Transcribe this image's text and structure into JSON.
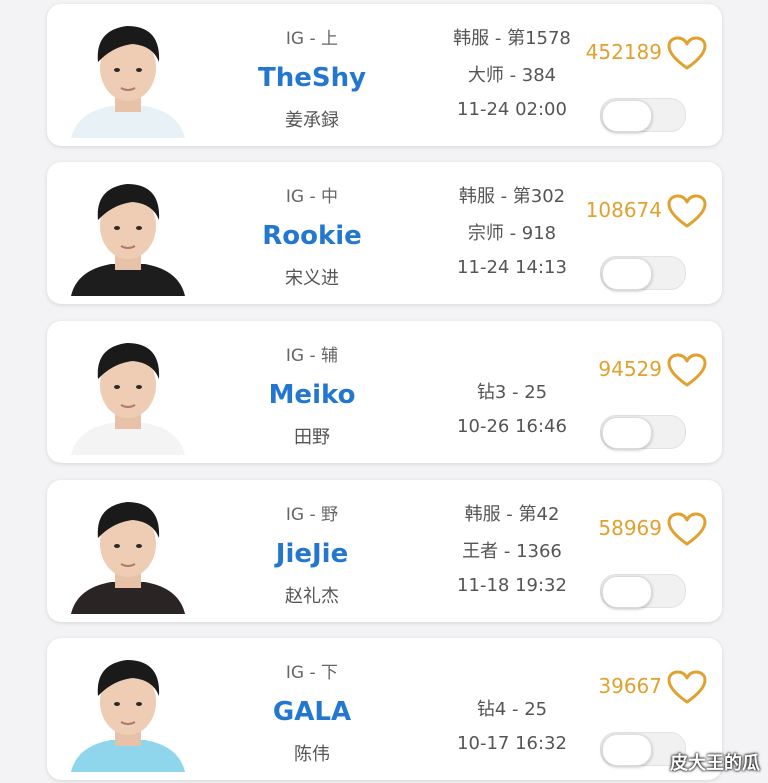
{
  "players": [
    {
      "team": "IG - 上",
      "name": "TheShy",
      "realname": "姜承録",
      "stats": [
        "韩服 - 第1578",
        "大师 - 384",
        "11-24 02:00"
      ],
      "votes": "452189",
      "shirt": "#e8f1f6"
    },
    {
      "team": "IG - 中",
      "name": "Rookie",
      "realname": "宋义进",
      "stats": [
        "韩服 - 第302",
        "宗师 - 918",
        "11-24 14:13"
      ],
      "votes": "108674",
      "shirt": "#1d1d1d"
    },
    {
      "team": "IG - 辅",
      "name": "Meiko",
      "realname": "田野",
      "stats": [
        "钻3 - 25",
        "10-26 16:46"
      ],
      "votes": "94529",
      "shirt": "#f4f4f4"
    },
    {
      "team": "IG - 野",
      "name": "JieJie",
      "realname": "赵礼杰",
      "stats": [
        "韩服 - 第42",
        "王者 - 1366",
        "11-18 19:32"
      ],
      "votes": "58969",
      "shirt": "#2a2424"
    },
    {
      "team": "IG - 下",
      "name": "GALA",
      "realname": "陈伟",
      "stats": [
        "钻4 - 25",
        "10-17 16:32"
      ],
      "votes": "39667",
      "shirt": "#8fd6ec"
    }
  ],
  "watermark": "皮大王的瓜",
  "colors": {
    "accent": "#2477cf",
    "votes": "#e0a12e"
  },
  "icons": {
    "vote": "heart-icon",
    "toggle": "toggle-switch"
  }
}
